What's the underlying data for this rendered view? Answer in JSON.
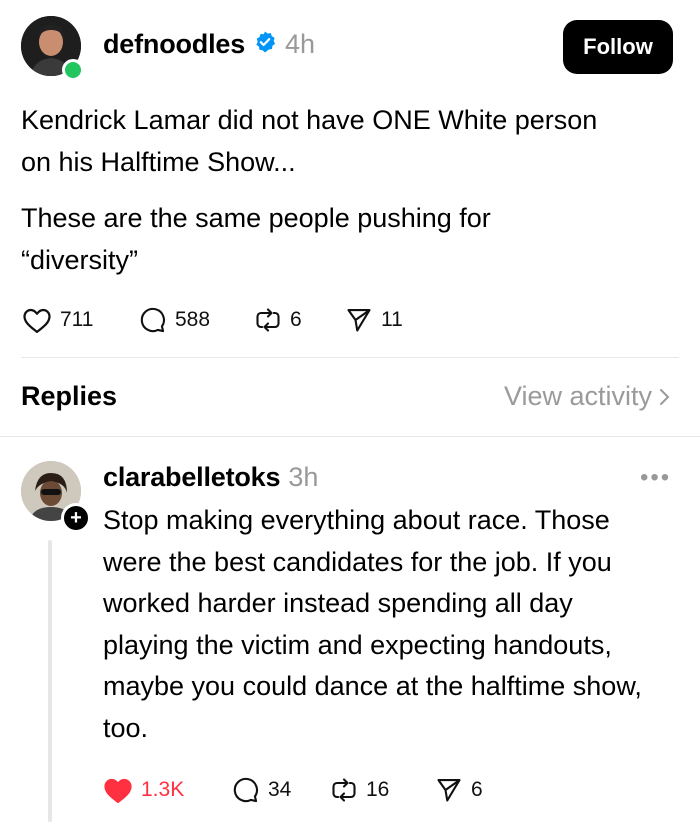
{
  "post": {
    "username": "defnoodles",
    "time": "4h",
    "follow_label": "Follow",
    "text_line1": "Kendrick Lamar did not have ONE White person",
    "text_line2": "on his Halftime Show...",
    "text_line3": "These are the same people pushing for",
    "text_line4": "“diversity”",
    "likes": "711",
    "comments": "588",
    "reposts": "6",
    "shares": "11"
  },
  "replies_header": {
    "title": "Replies",
    "view_activity": "View activity"
  },
  "reply": {
    "username": "clarabelletoks",
    "time": "3h",
    "text": "Stop making everything about race. Those were the best candidates for the job. If you worked harder instead spending all day playing the victim and expecting handouts, maybe you could dance at the halftime show, too.",
    "likes": "1.3K",
    "comments": "34",
    "reposts": "16",
    "shares": "6",
    "liked": true
  },
  "colors": {
    "verified": "#0095f6",
    "like_red": "#ff3040",
    "online": "#22c55e"
  },
  "icons": [
    "verified-badge-icon",
    "heart-icon",
    "comment-icon",
    "repost-icon",
    "share-icon",
    "chevron-right-icon",
    "more-icon",
    "plus-icon"
  ]
}
